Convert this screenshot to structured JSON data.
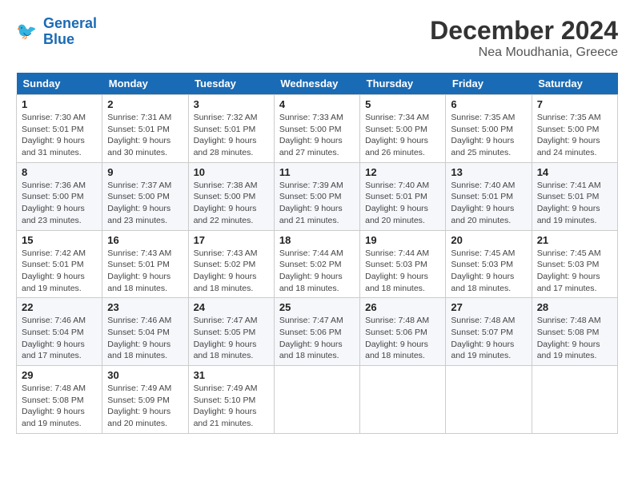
{
  "header": {
    "logo_line1": "General",
    "logo_line2": "Blue",
    "month_year": "December 2024",
    "location": "Nea Moudhania, Greece"
  },
  "weekdays": [
    "Sunday",
    "Monday",
    "Tuesday",
    "Wednesday",
    "Thursday",
    "Friday",
    "Saturday"
  ],
  "weeks": [
    [
      {
        "day": "1",
        "info": "Sunrise: 7:30 AM\nSunset: 5:01 PM\nDaylight: 9 hours\nand 31 minutes."
      },
      {
        "day": "2",
        "info": "Sunrise: 7:31 AM\nSunset: 5:01 PM\nDaylight: 9 hours\nand 30 minutes."
      },
      {
        "day": "3",
        "info": "Sunrise: 7:32 AM\nSunset: 5:01 PM\nDaylight: 9 hours\nand 28 minutes."
      },
      {
        "day": "4",
        "info": "Sunrise: 7:33 AM\nSunset: 5:00 PM\nDaylight: 9 hours\nand 27 minutes."
      },
      {
        "day": "5",
        "info": "Sunrise: 7:34 AM\nSunset: 5:00 PM\nDaylight: 9 hours\nand 26 minutes."
      },
      {
        "day": "6",
        "info": "Sunrise: 7:35 AM\nSunset: 5:00 PM\nDaylight: 9 hours\nand 25 minutes."
      },
      {
        "day": "7",
        "info": "Sunrise: 7:35 AM\nSunset: 5:00 PM\nDaylight: 9 hours\nand 24 minutes."
      }
    ],
    [
      {
        "day": "8",
        "info": "Sunrise: 7:36 AM\nSunset: 5:00 PM\nDaylight: 9 hours\nand 23 minutes."
      },
      {
        "day": "9",
        "info": "Sunrise: 7:37 AM\nSunset: 5:00 PM\nDaylight: 9 hours\nand 23 minutes."
      },
      {
        "day": "10",
        "info": "Sunrise: 7:38 AM\nSunset: 5:00 PM\nDaylight: 9 hours\nand 22 minutes."
      },
      {
        "day": "11",
        "info": "Sunrise: 7:39 AM\nSunset: 5:00 PM\nDaylight: 9 hours\nand 21 minutes."
      },
      {
        "day": "12",
        "info": "Sunrise: 7:40 AM\nSunset: 5:01 PM\nDaylight: 9 hours\nand 20 minutes."
      },
      {
        "day": "13",
        "info": "Sunrise: 7:40 AM\nSunset: 5:01 PM\nDaylight: 9 hours\nand 20 minutes."
      },
      {
        "day": "14",
        "info": "Sunrise: 7:41 AM\nSunset: 5:01 PM\nDaylight: 9 hours\nand 19 minutes."
      }
    ],
    [
      {
        "day": "15",
        "info": "Sunrise: 7:42 AM\nSunset: 5:01 PM\nDaylight: 9 hours\nand 19 minutes."
      },
      {
        "day": "16",
        "info": "Sunrise: 7:43 AM\nSunset: 5:01 PM\nDaylight: 9 hours\nand 18 minutes."
      },
      {
        "day": "17",
        "info": "Sunrise: 7:43 AM\nSunset: 5:02 PM\nDaylight: 9 hours\nand 18 minutes."
      },
      {
        "day": "18",
        "info": "Sunrise: 7:44 AM\nSunset: 5:02 PM\nDaylight: 9 hours\nand 18 minutes."
      },
      {
        "day": "19",
        "info": "Sunrise: 7:44 AM\nSunset: 5:03 PM\nDaylight: 9 hours\nand 18 minutes."
      },
      {
        "day": "20",
        "info": "Sunrise: 7:45 AM\nSunset: 5:03 PM\nDaylight: 9 hours\nand 18 minutes."
      },
      {
        "day": "21",
        "info": "Sunrise: 7:45 AM\nSunset: 5:03 PM\nDaylight: 9 hours\nand 17 minutes."
      }
    ],
    [
      {
        "day": "22",
        "info": "Sunrise: 7:46 AM\nSunset: 5:04 PM\nDaylight: 9 hours\nand 17 minutes."
      },
      {
        "day": "23",
        "info": "Sunrise: 7:46 AM\nSunset: 5:04 PM\nDaylight: 9 hours\nand 18 minutes."
      },
      {
        "day": "24",
        "info": "Sunrise: 7:47 AM\nSunset: 5:05 PM\nDaylight: 9 hours\nand 18 minutes."
      },
      {
        "day": "25",
        "info": "Sunrise: 7:47 AM\nSunset: 5:06 PM\nDaylight: 9 hours\nand 18 minutes."
      },
      {
        "day": "26",
        "info": "Sunrise: 7:48 AM\nSunset: 5:06 PM\nDaylight: 9 hours\nand 18 minutes."
      },
      {
        "day": "27",
        "info": "Sunrise: 7:48 AM\nSunset: 5:07 PM\nDaylight: 9 hours\nand 19 minutes."
      },
      {
        "day": "28",
        "info": "Sunrise: 7:48 AM\nSunset: 5:08 PM\nDaylight: 9 hours\nand 19 minutes."
      }
    ],
    [
      {
        "day": "29",
        "info": "Sunrise: 7:48 AM\nSunset: 5:08 PM\nDaylight: 9 hours\nand 19 minutes."
      },
      {
        "day": "30",
        "info": "Sunrise: 7:49 AM\nSunset: 5:09 PM\nDaylight: 9 hours\nand 20 minutes."
      },
      {
        "day": "31",
        "info": "Sunrise: 7:49 AM\nSunset: 5:10 PM\nDaylight: 9 hours\nand 21 minutes."
      },
      {
        "day": "",
        "info": ""
      },
      {
        "day": "",
        "info": ""
      },
      {
        "day": "",
        "info": ""
      },
      {
        "day": "",
        "info": ""
      }
    ]
  ]
}
